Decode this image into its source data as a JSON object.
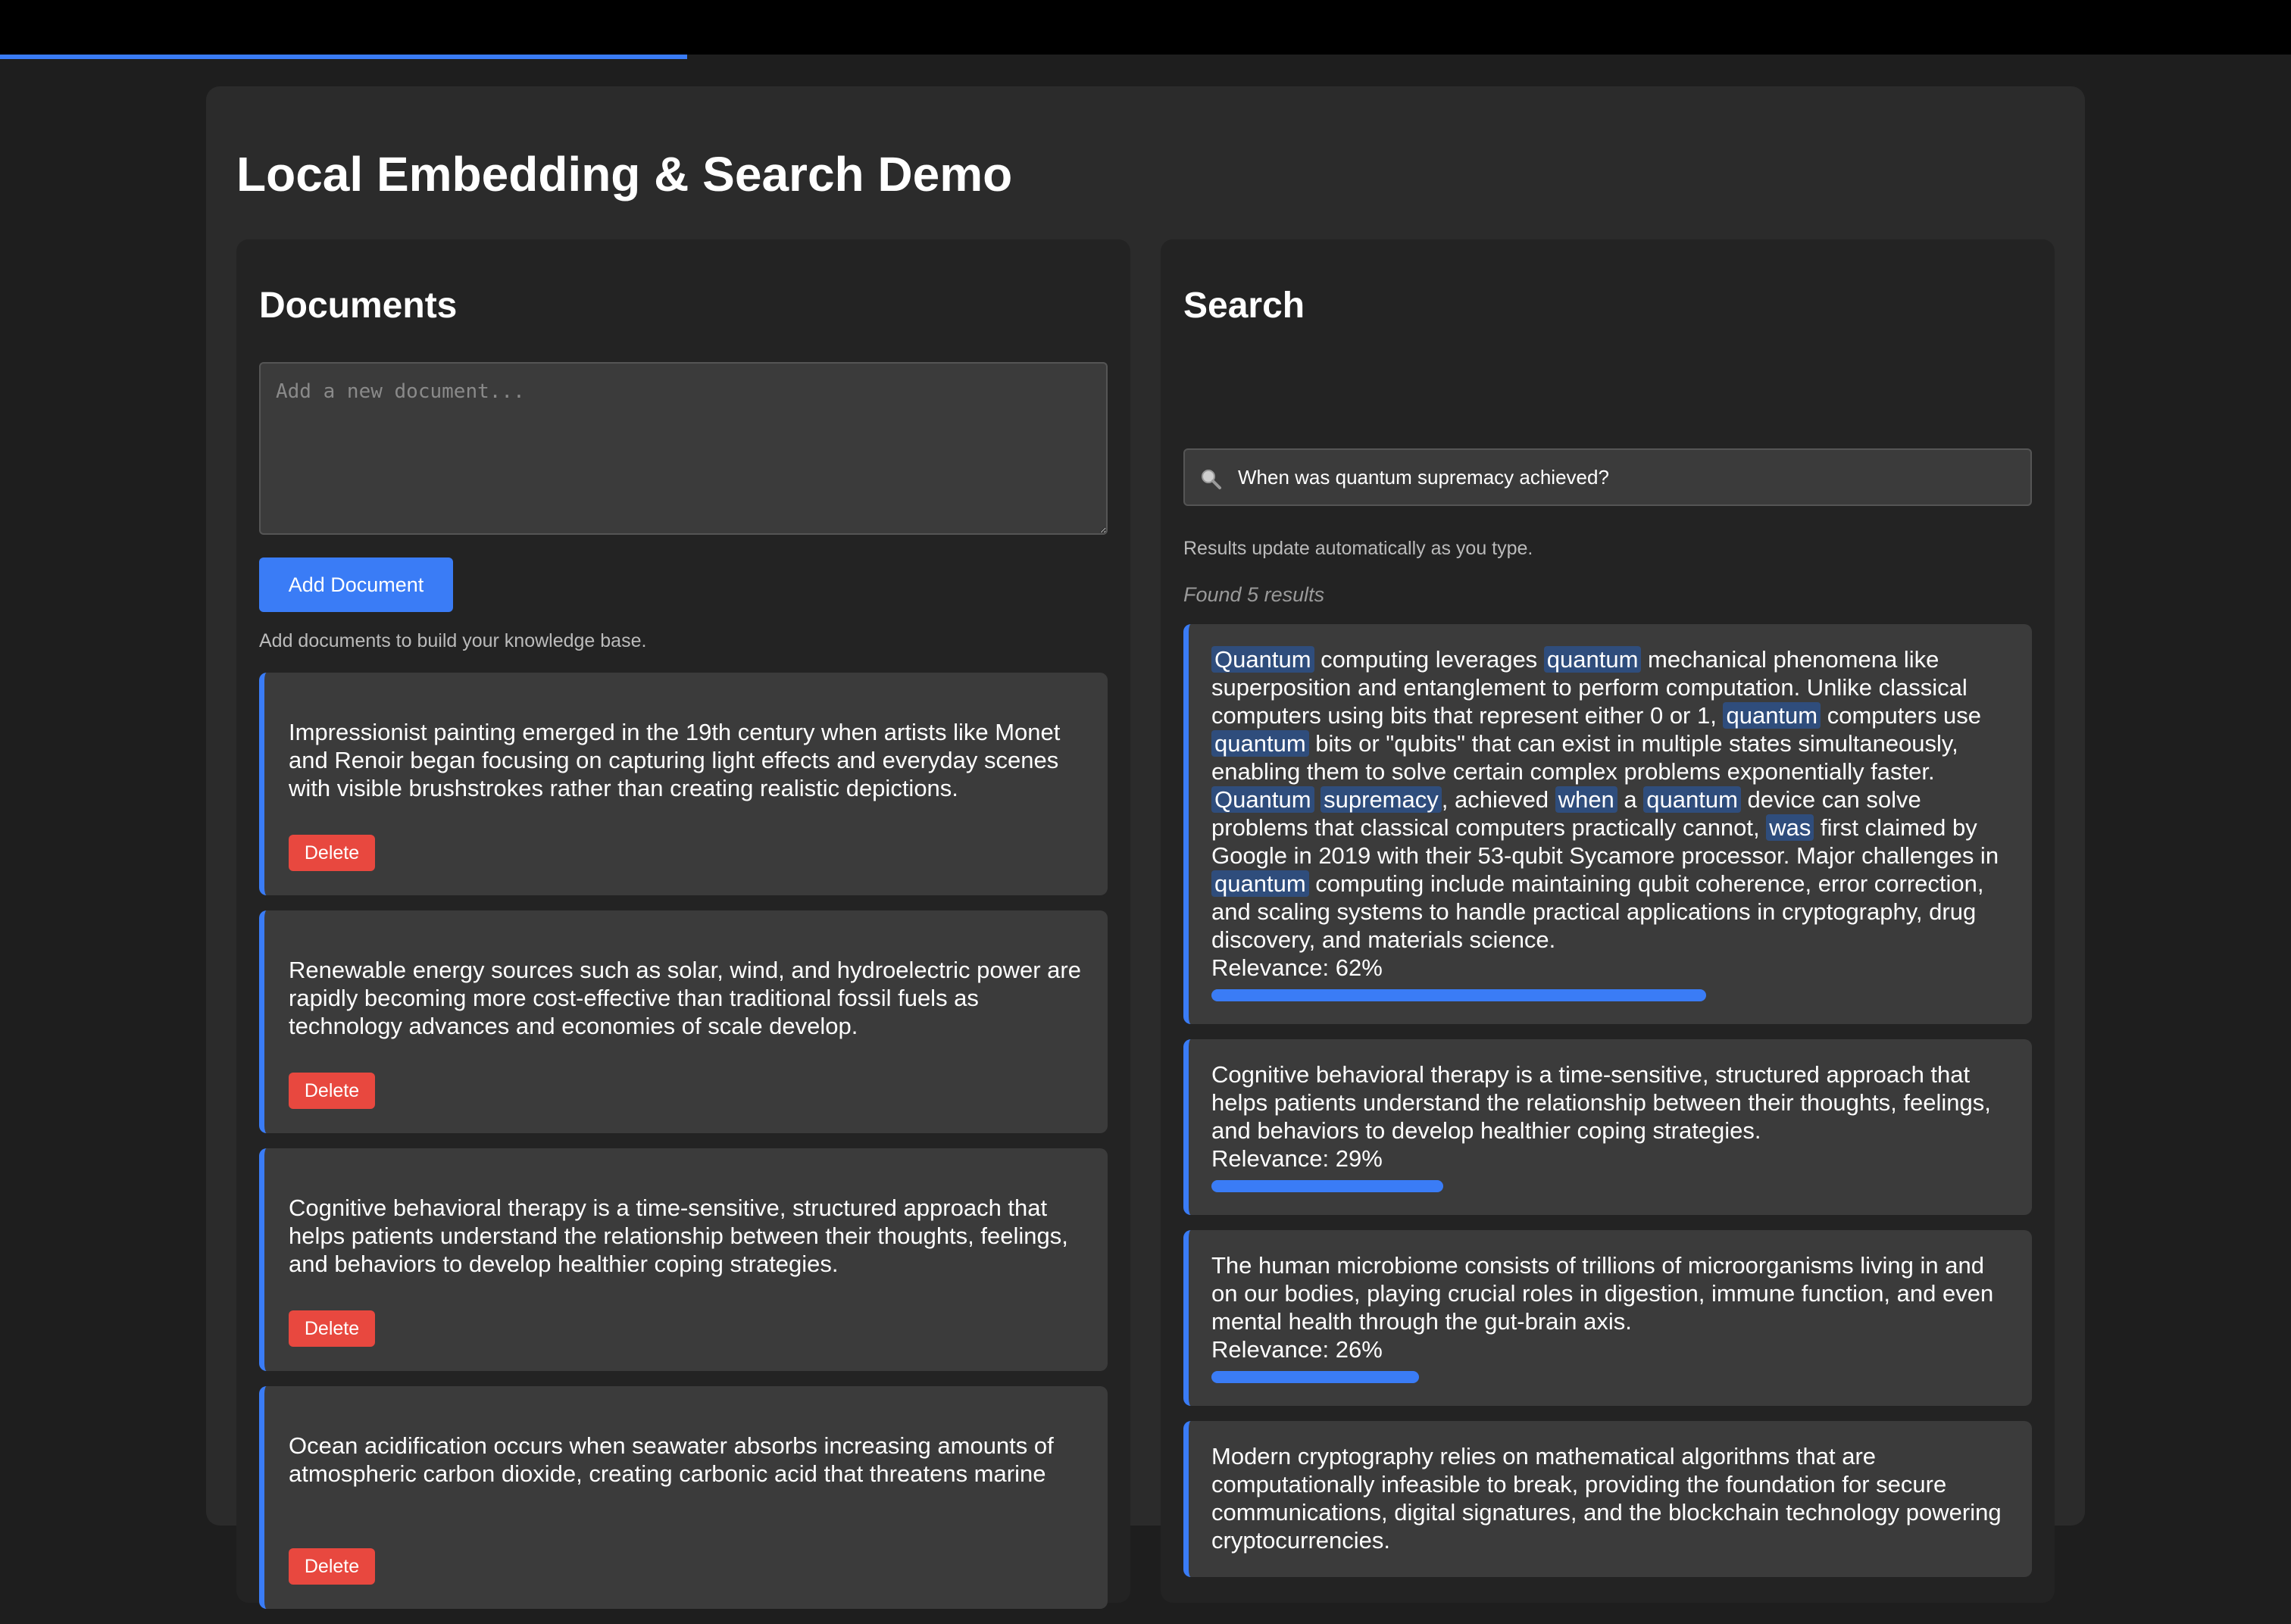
{
  "app": {
    "title": "Local Embedding & Search Demo",
    "accent_color": "#3a7cf6",
    "danger_color": "#e8483f",
    "page_progress": 0.3
  },
  "documents_panel": {
    "heading": "Documents",
    "input_placeholder": "Add a new document...",
    "add_button_label": "Add Document",
    "hint": "Add documents to build your knowledge base.",
    "delete_label": "Delete",
    "docs": [
      {
        "text": "Impressionist painting emerged in the 19th century when artists like Monet and Renoir began focusing on capturing light effects and everyday scenes with visible brushstrokes rather than creating realistic depictions."
      },
      {
        "text": "Renewable energy sources such as solar, wind, and hydroelectric power are rapidly becoming more cost-effective than traditional fossil fuels as technology advances and economies of scale develop."
      },
      {
        "text": "Cognitive behavioral therapy is a time-sensitive, structured approach that helps patients understand the relationship between their thoughts, feelings, and behaviors to develop healthier coping strategies."
      },
      {
        "text": "Ocean acidification occurs when seawater absorbs increasing amounts of atmospheric carbon dioxide, creating carbonic acid that threatens marine"
      }
    ]
  },
  "search_panel": {
    "heading": "Search",
    "search_icon": "magnifier-icon",
    "query": "When was quantum supremacy achieved?",
    "hint": "Results update automatically as you type.",
    "results_count": "Found 5 results",
    "relevance_prefix": "Relevance: ",
    "results": [
      {
        "segments": [
          {
            "t": "Quantum",
            "hl": true
          },
          {
            "t": " computing leverages "
          },
          {
            "t": "quantum",
            "hl": true
          },
          {
            "t": " mechanical phenomena like superposition and entanglement to perform computation. Unlike classical computers using bits that represent either 0 or 1, "
          },
          {
            "t": "quantum",
            "hl": true
          },
          {
            "t": " computers use "
          },
          {
            "t": "quantum",
            "hl": true
          },
          {
            "t": " bits or \"qubits\" that can exist in multiple states simultaneously, enabling them to solve certain complex problems exponentially faster. "
          },
          {
            "t": "Quantum",
            "hl": true
          },
          {
            "t": " "
          },
          {
            "t": "supremacy",
            "hl": true
          },
          {
            "t": ", achieved "
          },
          {
            "t": "when",
            "hl": true
          },
          {
            "t": " a "
          },
          {
            "t": "quantum",
            "hl": true
          },
          {
            "t": " device can solve problems that classical computers practically cannot, "
          },
          {
            "t": "was",
            "hl": true
          },
          {
            "t": " first claimed by Google in 2019 with their 53-qubit Sycamore processor. Major challenges in "
          },
          {
            "t": "quantum",
            "hl": true
          },
          {
            "t": " computing include maintaining qubit coherence, error correction, and scaling systems to handle practical applications in cryptography, drug discovery, and materials science."
          }
        ],
        "relevance": 62
      },
      {
        "segments": [
          {
            "t": "Cognitive behavioral therapy is a time-sensitive, structured approach that helps patients understand the relationship between their thoughts, feelings, and behaviors to develop healthier coping strategies."
          }
        ],
        "relevance": 29
      },
      {
        "segments": [
          {
            "t": "The human microbiome consists of trillions of microorganisms living in and on our bodies, playing crucial roles in digestion, immune function, and even mental health through the gut-brain axis."
          }
        ],
        "relevance": 26
      },
      {
        "segments": [
          {
            "t": "Modern cryptography relies on mathematical algorithms that are computationally infeasible to break, providing the foundation for secure communications, digital signatures, and the blockchain technology powering cryptocurrencies."
          }
        ],
        "relevance": null
      }
    ]
  }
}
